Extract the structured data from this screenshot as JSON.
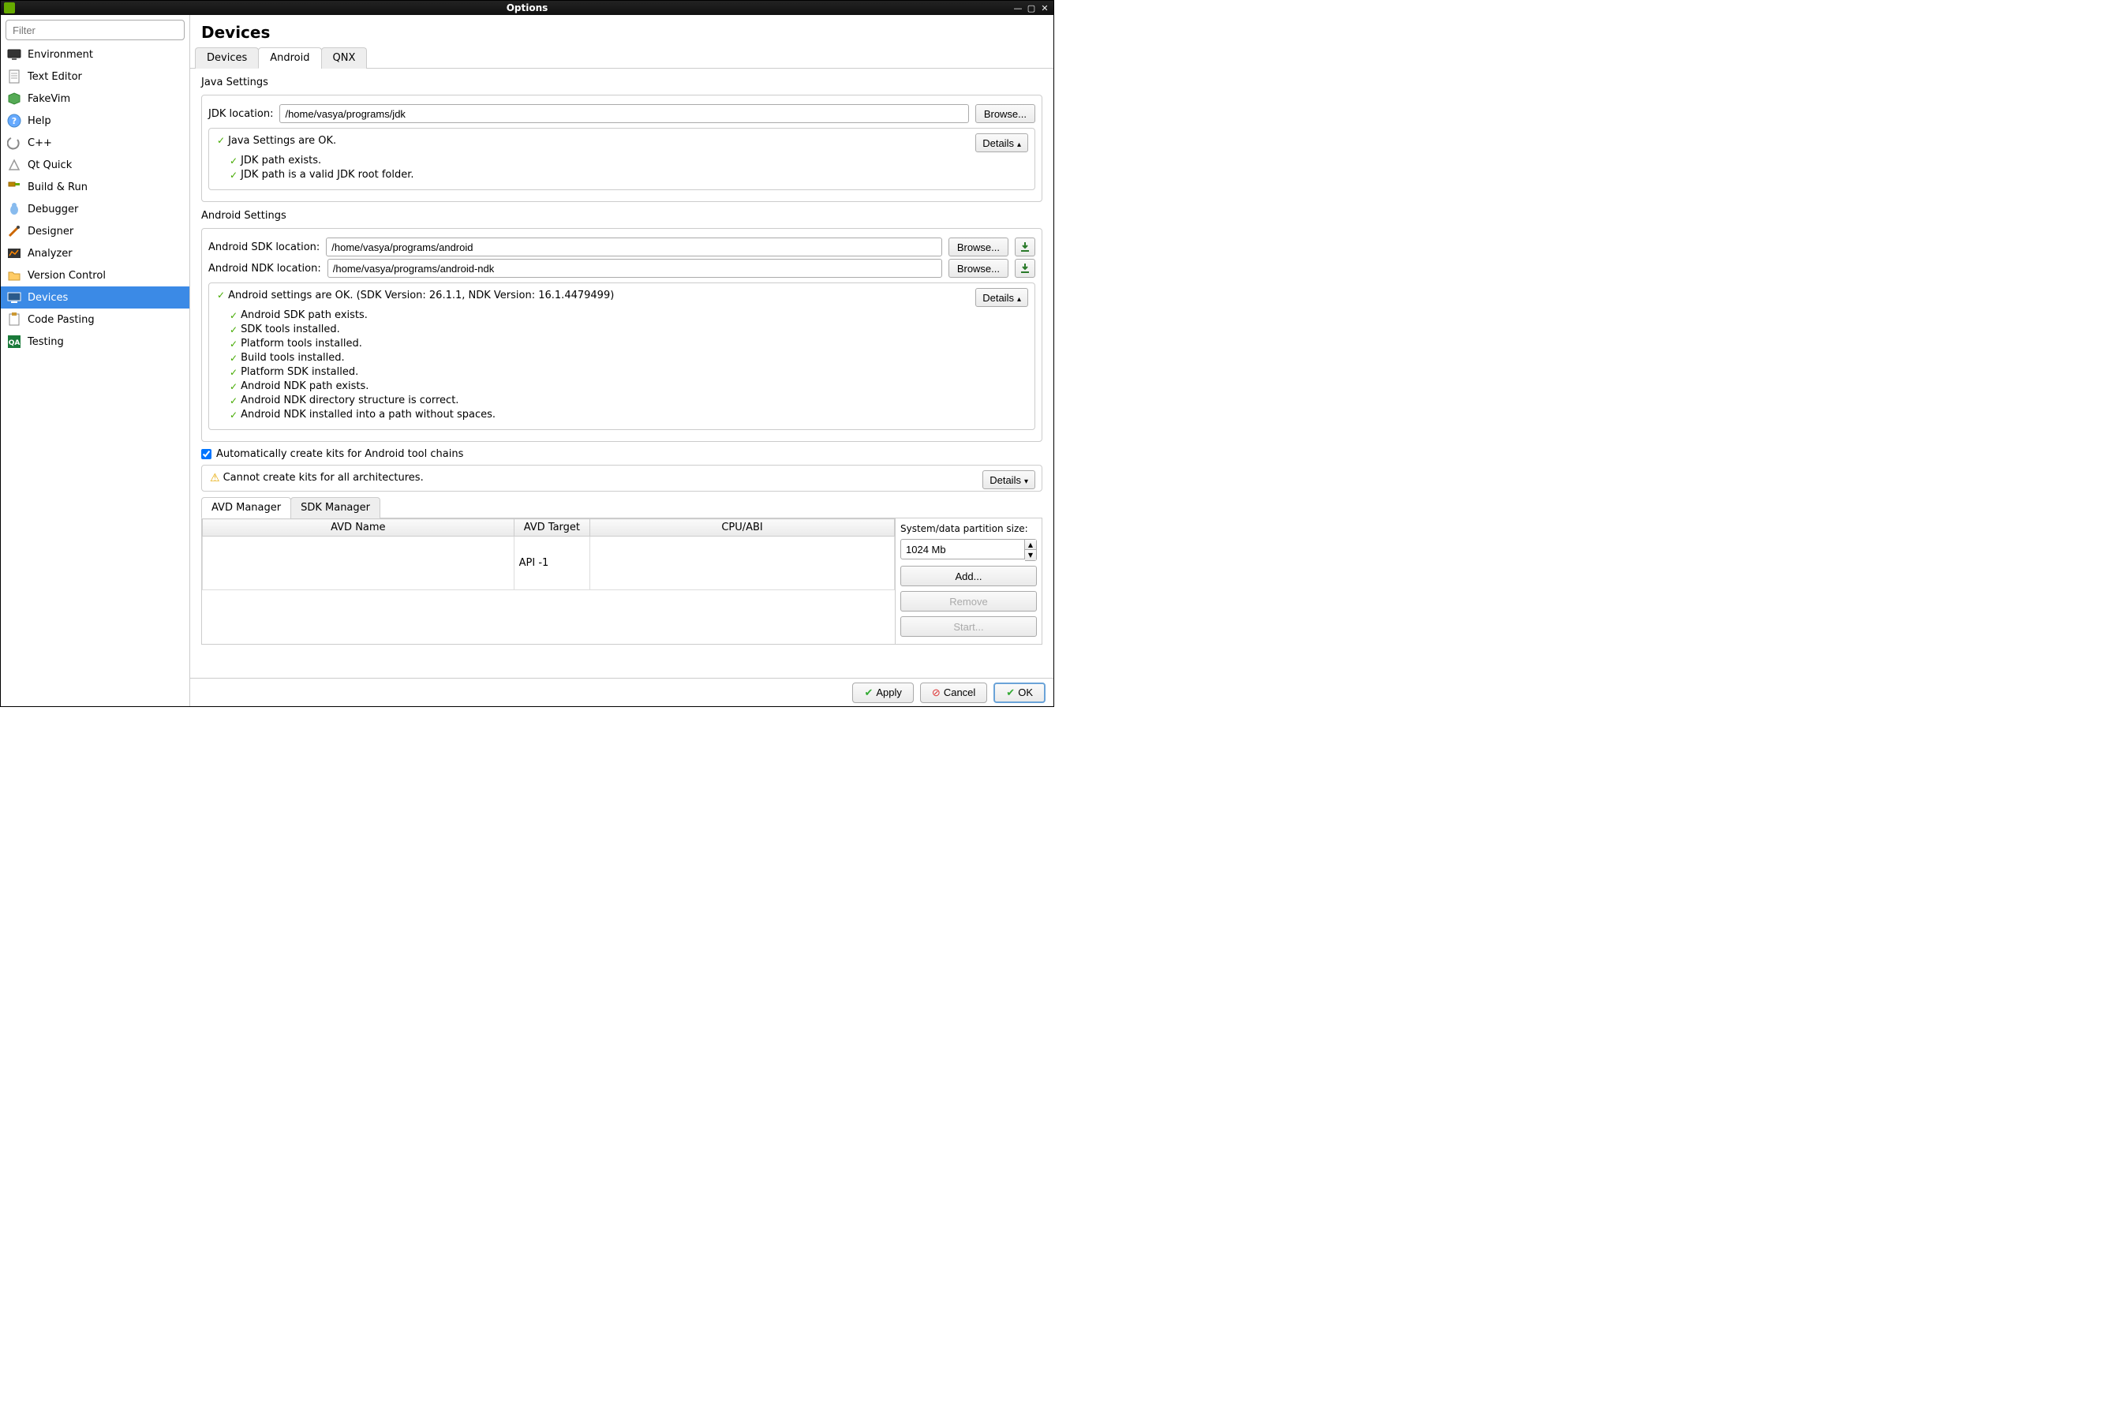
{
  "window": {
    "title": "Options"
  },
  "sidebar": {
    "filter_placeholder": "Filter",
    "items": [
      {
        "label": "Environment"
      },
      {
        "label": "Text Editor"
      },
      {
        "label": "FakeVim"
      },
      {
        "label": "Help"
      },
      {
        "label": "C++"
      },
      {
        "label": "Qt Quick"
      },
      {
        "label": "Build & Run"
      },
      {
        "label": "Debugger"
      },
      {
        "label": "Designer"
      },
      {
        "label": "Analyzer"
      },
      {
        "label": "Version Control"
      },
      {
        "label": "Devices"
      },
      {
        "label": "Code Pasting"
      },
      {
        "label": "Testing"
      }
    ],
    "selected_index": 11
  },
  "page": {
    "title": "Devices",
    "tabs": {
      "devices": "Devices",
      "android": "Android",
      "qnx": "QNX",
      "active": "android"
    }
  },
  "java": {
    "section_title": "Java Settings",
    "jdk_label": "JDK location:",
    "jdk_value": "/home/vasya/programs/jdk",
    "browse": "Browse...",
    "status": "Java Settings are OK.",
    "details_label": "Details",
    "checks": [
      "JDK path exists.",
      "JDK path is a valid JDK root folder."
    ]
  },
  "android": {
    "section_title": "Android Settings",
    "sdk_label": "Android SDK location:",
    "sdk_value": "/home/vasya/programs/android",
    "ndk_label": "Android NDK location:",
    "ndk_value": "/home/vasya/programs/android-ndk",
    "browse": "Browse...",
    "status": "Android settings are OK. (SDK Version: 26.1.1, NDK Version: 16.1.4479499)",
    "details_label": "Details",
    "checks": [
      "Android SDK path exists.",
      "SDK tools installed.",
      "Platform tools installed.",
      "Build tools installed.",
      "Platform SDK installed.",
      "Android NDK path exists.",
      "Android NDK directory structure is correct.",
      "Android NDK installed into a path without spaces."
    ]
  },
  "kits": {
    "auto_create_label": "Automatically create kits for Android tool chains",
    "auto_create_checked": true,
    "warning": "Cannot create kits for all architectures.",
    "details_label": "Details"
  },
  "avd": {
    "tabs": {
      "avd_manager": "AVD Manager",
      "sdk_manager": "SDK Manager",
      "active": "avd_manager"
    },
    "columns": {
      "name": "AVD Name",
      "target": "AVD Target",
      "cpu": "CPU/ABI"
    },
    "rows": [
      {
        "name": "",
        "target": "API -1",
        "cpu": ""
      }
    ],
    "side": {
      "partition_label": "System/data partition size:",
      "partition_value": "1024 Mb",
      "add": "Add...",
      "remove": "Remove",
      "start": "Start..."
    }
  },
  "footer": {
    "apply": "Apply",
    "cancel": "Cancel",
    "ok": "OK"
  }
}
